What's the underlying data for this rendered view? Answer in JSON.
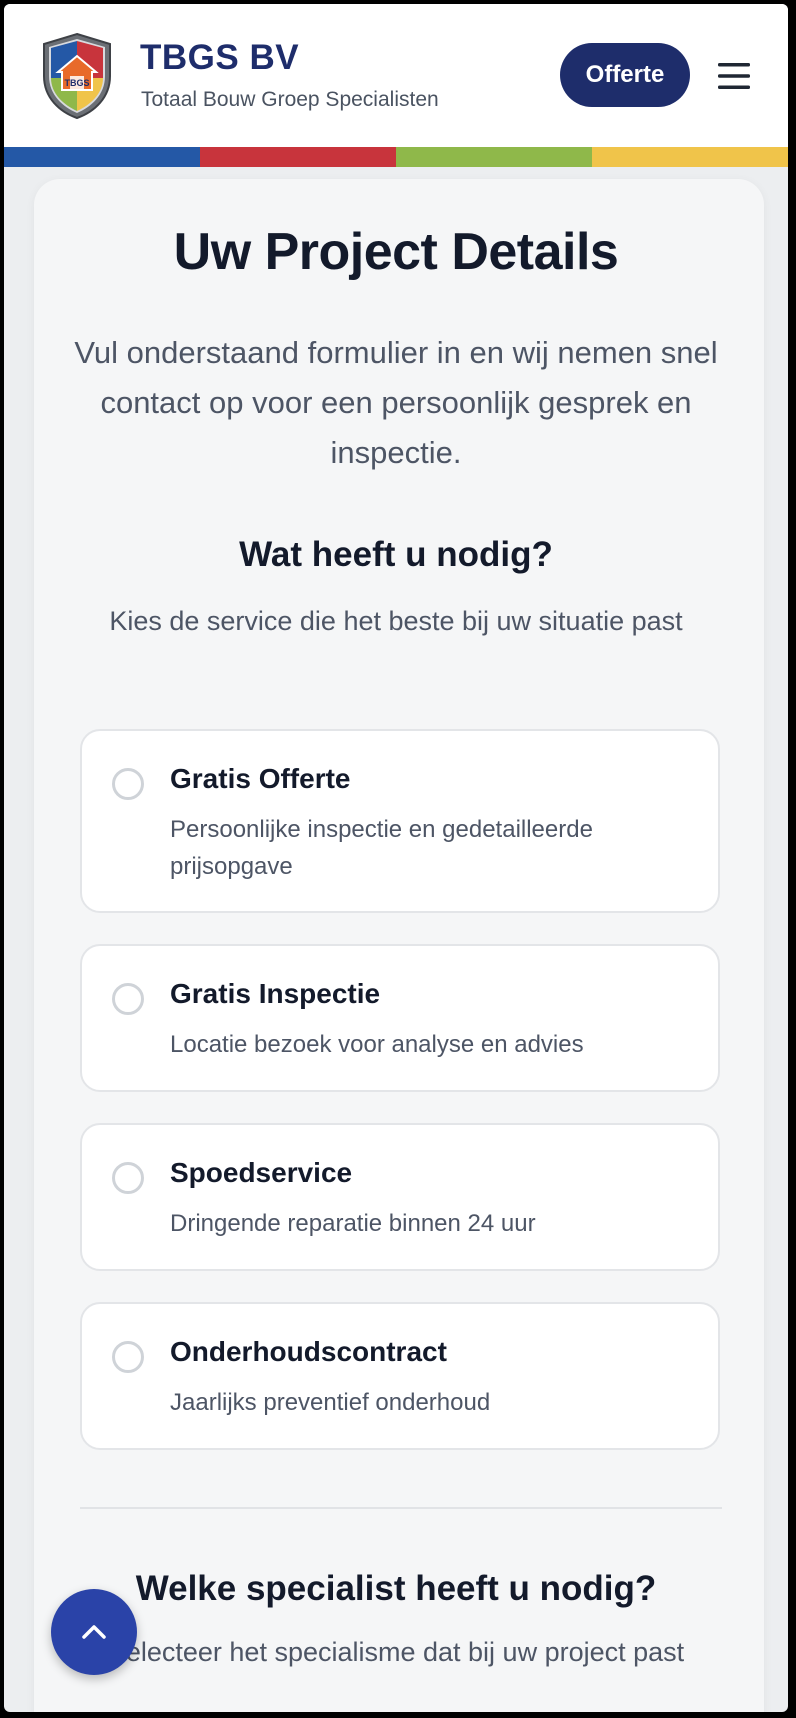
{
  "header": {
    "brand_title": "TBGS BV",
    "brand_subtitle": "Totaal Bouw Groep Specialisten",
    "logo_text": "TBGS",
    "cta_label": "Offerte",
    "menu_icon": "hamburger-icon"
  },
  "color_bar": [
    "#2458a6",
    "#c8343c",
    "#8fb84a",
    "#f0c44a"
  ],
  "colors": {
    "brand_navy": "#1e2d6b",
    "accent_blue": "#2a43a8"
  },
  "main": {
    "title": "Uw Project Details",
    "intro": "Vul onderstaand formulier in en wij nemen snel contact op voor een persoonlijk gesprek en inspectie.",
    "service_section": {
      "title": "Wat heeft u nodig?",
      "subtitle": "Kies de service die het beste bij uw situatie past",
      "options": [
        {
          "title": "Gratis Offerte",
          "description": "Persoonlijke inspectie en gedetailleerde prijsopgave"
        },
        {
          "title": "Gratis Inspectie",
          "description": "Locatie bezoek voor analyse en advies"
        },
        {
          "title": "Spoedservice",
          "description": "Dringende reparatie binnen 24 uur"
        },
        {
          "title": "Onderhoudscontract",
          "description": "Jaarlijks preventief onderhoud"
        }
      ]
    },
    "specialist_section": {
      "title": "Welke specialist heeft u nodig?",
      "subtitle": "Selecteer het specialisme dat bij uw project past"
    }
  },
  "scroll_top_icon": "chevron-up-icon"
}
